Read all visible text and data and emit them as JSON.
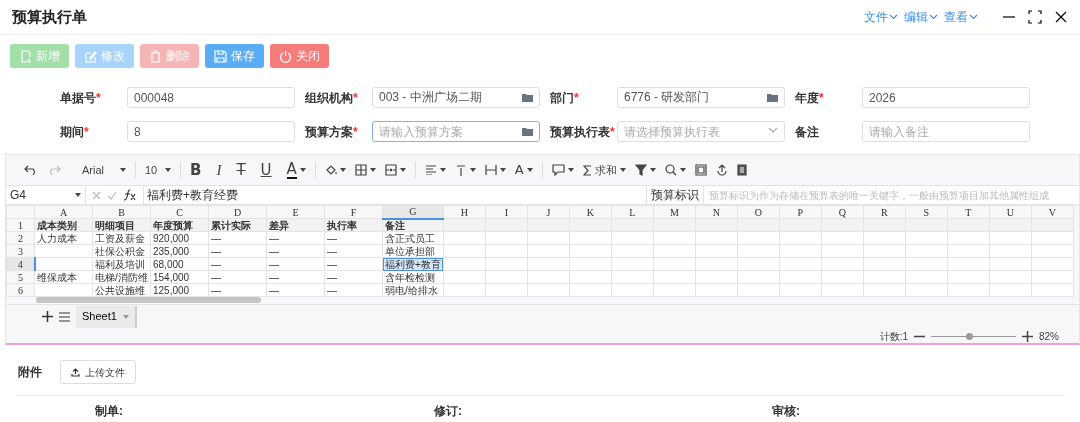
{
  "window": {
    "title": "预算执行单",
    "menus": [
      {
        "label": "文件"
      },
      {
        "label": "编辑"
      },
      {
        "label": "查看"
      }
    ]
  },
  "buttons": [
    {
      "label": "新增",
      "color": "#a3dfa8"
    },
    {
      "label": "修改",
      "color": "#a8d4fb"
    },
    {
      "label": "删除",
      "color": "#f5b5b5"
    },
    {
      "label": "保存",
      "color": "#5aacf6"
    },
    {
      "label": "关闭",
      "color": "#f67b7b"
    }
  ],
  "form": [
    {
      "label": "单据号",
      "required_mark": "*",
      "value": "000048",
      "kind": "text"
    },
    {
      "label": "组织机构",
      "required_mark": "*",
      "value": "003 - 中洲广场二期",
      "kind": "folder"
    },
    {
      "label": "部门",
      "required_mark": "*",
      "value": "6776 - 研发部门",
      "kind": "folder"
    },
    {
      "label": "年度",
      "required_mark": "*",
      "value": "2026",
      "kind": "text"
    },
    {
      "label": "期间",
      "required_mark": "*",
      "value": "8",
      "kind": "text"
    },
    {
      "label": "预算方案",
      "required_mark": "*",
      "placeholder": "请输入预算方案",
      "kind": "folder",
      "focused": true
    },
    {
      "label": "预算执行表",
      "required_mark": "*",
      "placeholder": "请选择预算执行表",
      "kind": "select"
    },
    {
      "label": "备注",
      "placeholder": "请输入备注",
      "kind": "text"
    }
  ],
  "sheet": {
    "toolbar": {
      "font": "Arial",
      "size": "10",
      "bold": "B",
      "italic": "I",
      "strike": "T",
      "underline": "U",
      "font_glyph": "A",
      "wrap_glyph": "A",
      "sum": "求和"
    },
    "name_box": "G4",
    "formula": "福利费+教育经费",
    "tag_label": "预算标识",
    "tag_placeholder": "预算标识为作为存储在预算表的唯一关键字，一般由预算项目加其他属性组成",
    "columns": [
      {
        "letter": "A",
        "selected": false
      },
      {
        "letter": "B",
        "selected": false
      },
      {
        "letter": "C",
        "selected": false
      },
      {
        "letter": "D",
        "selected": false
      },
      {
        "letter": "E",
        "selected": false
      },
      {
        "letter": "F",
        "selected": false
      },
      {
        "letter": "G",
        "selected": true
      },
      {
        "letter": "H",
        "selected": false
      },
      {
        "letter": "I",
        "selected": false
      },
      {
        "letter": "J",
        "selected": false
      },
      {
        "letter": "K",
        "selected": false
      },
      {
        "letter": "L",
        "selected": false
      },
      {
        "letter": "M",
        "selected": false
      },
      {
        "letter": "N",
        "selected": false
      },
      {
        "letter": "O",
        "selected": false
      },
      {
        "letter": "P",
        "selected": false
      },
      {
        "letter": "Q",
        "selected": false
      },
      {
        "letter": "R",
        "selected": false
      },
      {
        "letter": "S",
        "selected": false
      },
      {
        "letter": "T",
        "selected": false
      },
      {
        "letter": "U",
        "selected": false
      },
      {
        "letter": "V",
        "selected": false
      }
    ],
    "rows": [
      {
        "number": "1",
        "selected": false,
        "kind": "header",
        "cells": [
          "成本类别",
          "明细项目",
          "年度预算",
          "累计实际",
          "差异",
          "执行率",
          "备注"
        ]
      },
      {
        "number": "2",
        "selected": false,
        "kind": "data",
        "cells": [
          "人力成本",
          "工资及薪金",
          "920,000",
          "—",
          "—",
          "—",
          "含正式员工"
        ]
      },
      {
        "number": "3",
        "selected": false,
        "kind": "data",
        "cells": [
          null,
          "社保公积金",
          "235,000",
          "—",
          "—",
          "—",
          "单位承担部"
        ]
      },
      {
        "number": "4",
        "selected": true,
        "kind": "data",
        "cells": [
          null,
          "福利及培训",
          "68,000",
          "—",
          "—",
          "—",
          "福利费+教育"
        ]
      },
      {
        "number": "5",
        "selected": false,
        "kind": "data",
        "cells": [
          "维保成本",
          "电梯/消防维",
          "154,000",
          "—",
          "—",
          "—",
          "含年检检测"
        ]
      },
      {
        "number": "6",
        "selected": false,
        "kind": "data",
        "cells": [
          null,
          "公共设施维",
          "125,000",
          "—",
          "—",
          "—",
          "弱电/给排水"
        ]
      }
    ],
    "tabs": [
      {
        "label": "Sheet1",
        "selected": true
      }
    ],
    "status": {
      "count": "计数:1",
      "zoom": "82%",
      "level": 0.45
    }
  },
  "attachments": {
    "label": "附件",
    "button": "上传文件"
  },
  "signatures": [
    {
      "label": "制单:"
    },
    {
      "label": "修订:"
    },
    {
      "label": "审核:"
    }
  ]
}
